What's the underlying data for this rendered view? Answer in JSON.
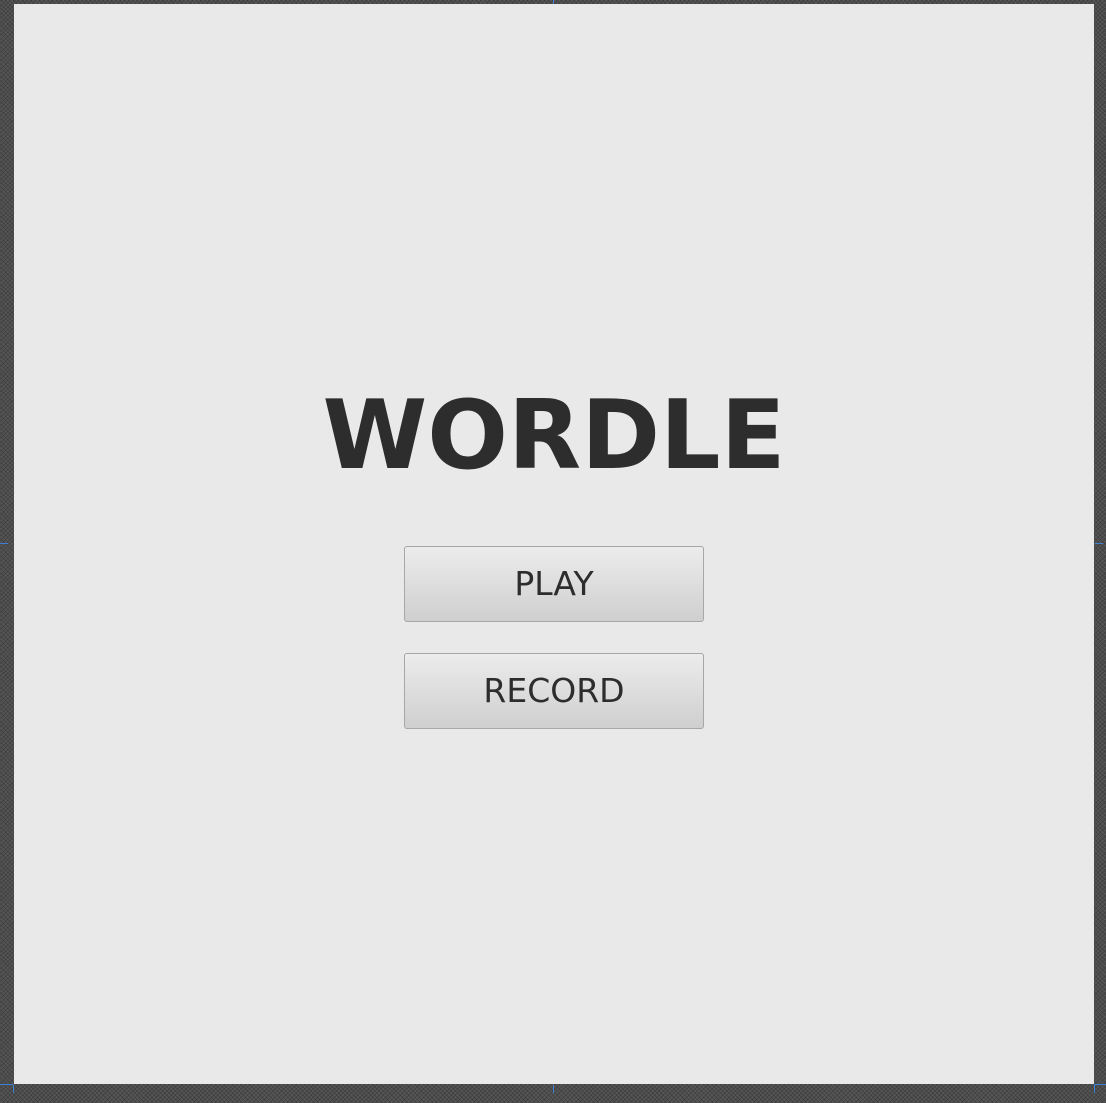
{
  "game": {
    "title": "WORDLE",
    "play_label": "PLAY",
    "record_label": "RECORD"
  },
  "colors": {
    "background": "#e9e9e9",
    "text": "#2d2d2d",
    "button_border": "#a7a7a7",
    "selection_marker": "#3c7fd6"
  }
}
